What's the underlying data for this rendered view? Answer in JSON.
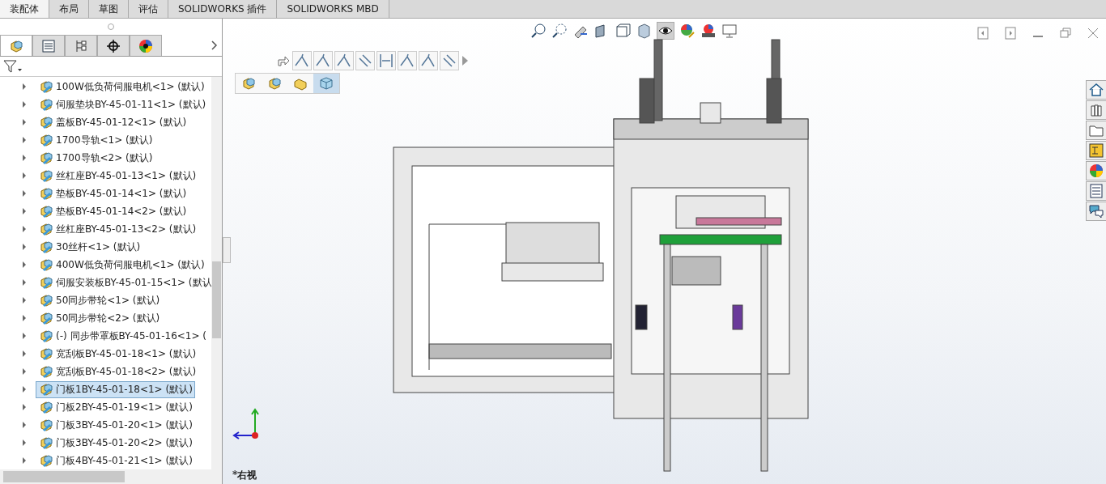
{
  "command_tabs": [
    {
      "label": "装配体",
      "selected": true
    },
    {
      "label": "布局",
      "selected": false
    },
    {
      "label": "草图",
      "selected": false
    },
    {
      "label": "评估",
      "selected": false
    },
    {
      "label": "SOLIDWORKS 插件",
      "selected": false
    },
    {
      "label": "SOLIDWORKS MBD",
      "selected": false
    }
  ],
  "panel_tabs": [
    {
      "kind": "feature",
      "selected": true
    },
    {
      "kind": "property",
      "selected": false
    },
    {
      "kind": "config",
      "selected": false
    },
    {
      "kind": "dim",
      "selected": false
    },
    {
      "kind": "display",
      "selected": false
    }
  ],
  "tree": {
    "items": [
      {
        "label": "100W低负荷伺服电机<1> (默认)",
        "selected": false
      },
      {
        "label": "伺服垫块BY-45-01-11<1> (默认)",
        "selected": false
      },
      {
        "label": "盖板BY-45-01-12<1> (默认)",
        "selected": false
      },
      {
        "label": "1700导轨<1> (默认)",
        "selected": false
      },
      {
        "label": "1700导轨<2> (默认)",
        "selected": false
      },
      {
        "label": "丝杠座BY-45-01-13<1> (默认)",
        "selected": false
      },
      {
        "label": "垫板BY-45-01-14<1> (默认)",
        "selected": false
      },
      {
        "label": "垫板BY-45-01-14<2> (默认)",
        "selected": false
      },
      {
        "label": "丝杠座BY-45-01-13<2> (默认)",
        "selected": false
      },
      {
        "label": "30丝杆<1> (默认)",
        "selected": false
      },
      {
        "label": "400W低负荷伺服电机<1> (默认)",
        "selected": false
      },
      {
        "label": "伺服安装板BY-45-01-15<1> (默认",
        "selected": false
      },
      {
        "label": "50同步带轮<1> (默认)",
        "selected": false
      },
      {
        "label": "50同步带轮<2> (默认)",
        "selected": false
      },
      {
        "label": "(-) 同步带罩板BY-45-01-16<1> (",
        "selected": false
      },
      {
        "label": "宽刮板BY-45-01-18<1> (默认)",
        "selected": false
      },
      {
        "label": "宽刮板BY-45-01-18<2> (默认)",
        "selected": false
      },
      {
        "label": "门板1BY-45-01-18<1> (默认)",
        "selected": true
      },
      {
        "label": "门板2BY-45-01-19<1> (默认)",
        "selected": false
      },
      {
        "label": "门板3BY-45-01-20<1> (默认)",
        "selected": false
      },
      {
        "label": "门板3BY-45-01-20<2> (默认)",
        "selected": false
      },
      {
        "label": "门板4BY-45-01-21<1> (默认)",
        "selected": false
      }
    ]
  },
  "breadcrumb": [
    {
      "kind": "assembly",
      "selected": false
    },
    {
      "kind": "assembly",
      "selected": false
    },
    {
      "kind": "part",
      "selected": false
    },
    {
      "kind": "body",
      "selected": true
    }
  ],
  "view_label": "*右视"
}
